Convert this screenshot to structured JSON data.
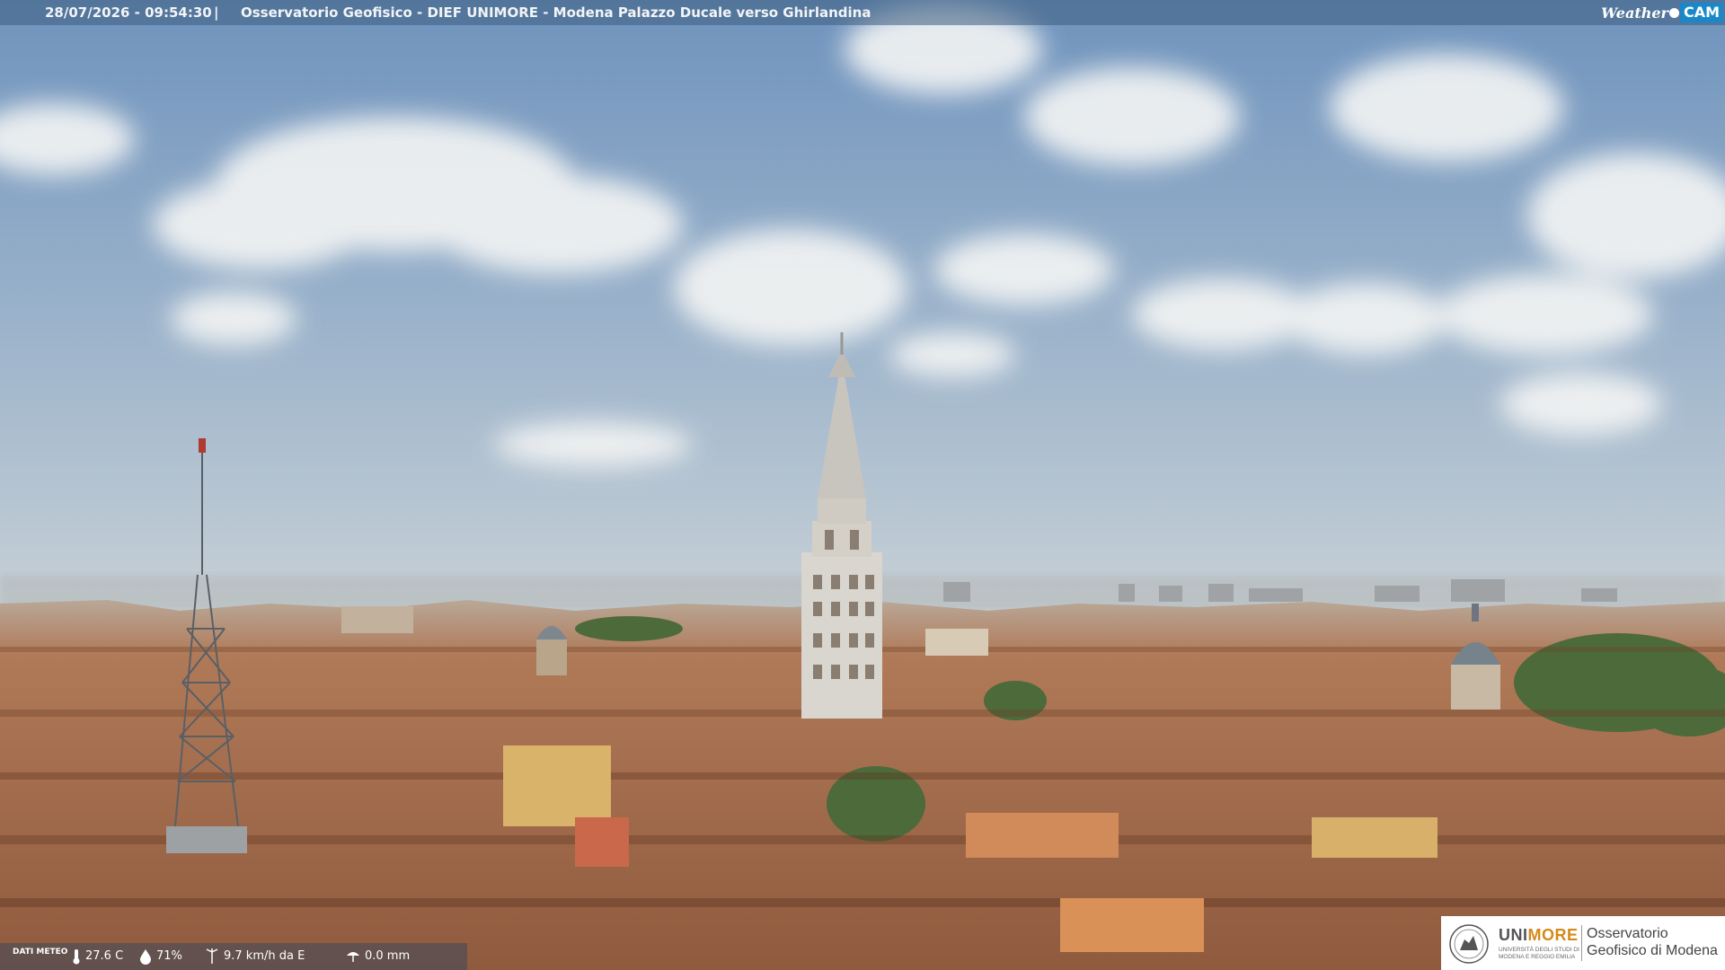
{
  "overlay": {
    "datetime": "28/07/2026 - 09:54:30",
    "separator": "|",
    "title": "Osservatorio Geofisico - DIEF UNIMORE - Modena Palazzo Ducale verso Ghirlandina"
  },
  "logo": {
    "weather": "Weather",
    "cam": "CAM",
    "cam_color": "#1a88c8"
  },
  "meteo": {
    "label": "DATI METEO",
    "temperature": "27.6 C",
    "humidity": "71%",
    "wind": "9.7 km/h da E",
    "rain": "0.0 mm",
    "icons": [
      "thermometer-icon",
      "humidity-drop-icon",
      "wind-icon",
      "rain-icon"
    ]
  },
  "branding": {
    "name_prefix": "UNI",
    "name_suffix": "MORE",
    "sub": "UNIVERSITÀ DEGLI STUDI DI MODENA E REGGIO EMILIA",
    "observatory": "Osservatorio Geofisico di Modena",
    "accent": "#d48a1b"
  },
  "scene": {
    "sky_top": "#6f93bd",
    "sky_horizon": "#c7d0d6",
    "roof_color": "#a5674a",
    "tower_color": "#d9d6cf"
  }
}
